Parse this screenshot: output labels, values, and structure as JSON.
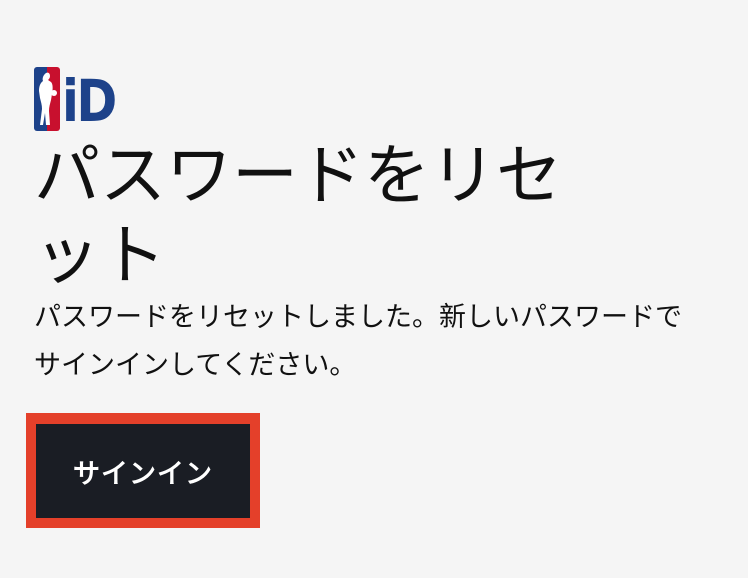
{
  "logo": {
    "text": "iD",
    "colors": {
      "blue": "#1d428a",
      "red": "#c8102e",
      "white": "#ffffff"
    }
  },
  "page_title": "パスワードをリセット",
  "message": "パスワードをリセットしました。新しいパスワードでサインインしてください。",
  "signin_button": {
    "label": "サインイン",
    "background": "#1a1d24",
    "focus_color": "#e4402a"
  }
}
